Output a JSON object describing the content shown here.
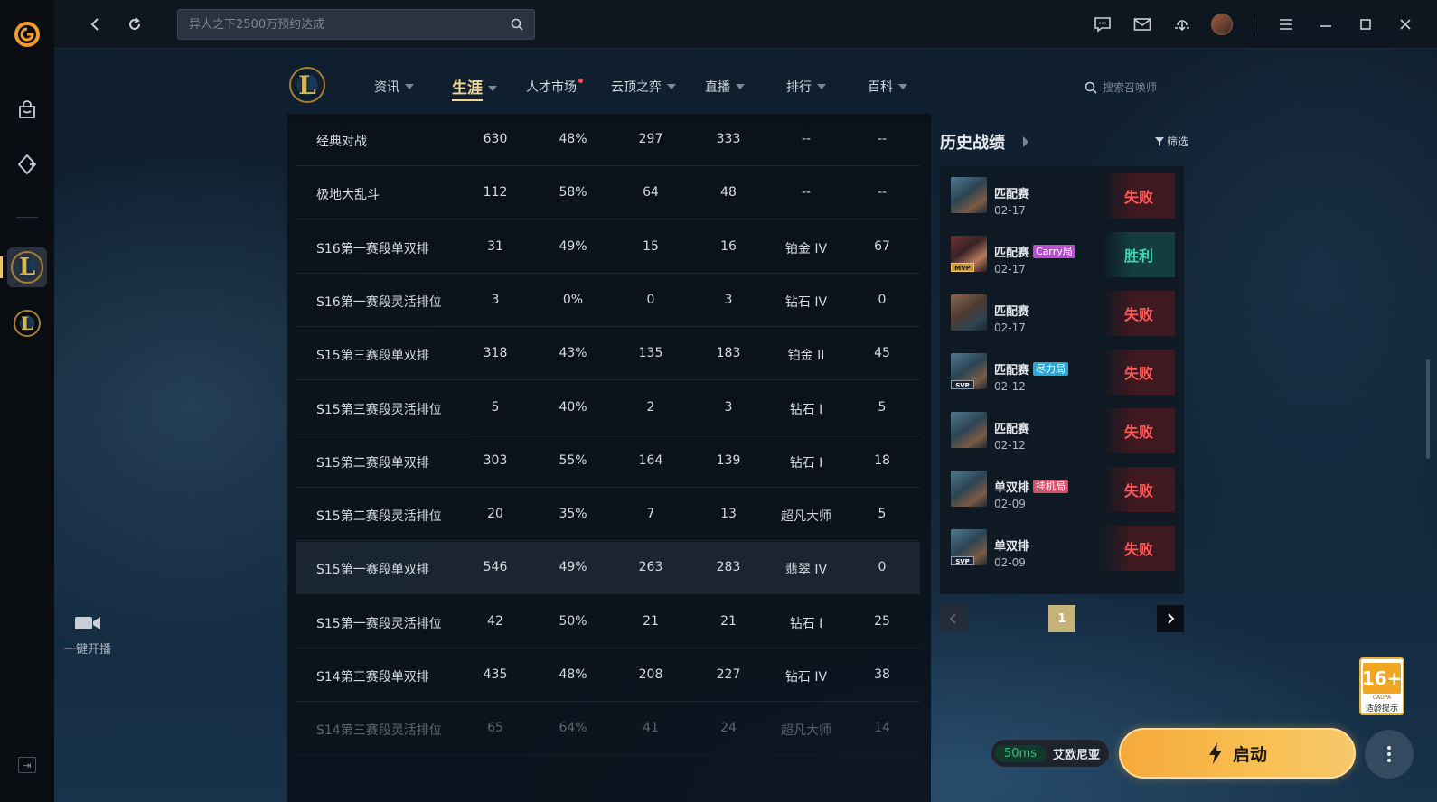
{
  "topbar": {
    "search_placeholder": "异人之下2500万预约达成",
    "icons": [
      "back-icon",
      "refresh-icon",
      "search-icon",
      "chat-icon",
      "mail-icon",
      "download-icon",
      "avatar",
      "menu-icon",
      "minimize-icon",
      "maximize-icon",
      "close-icon"
    ]
  },
  "rail": {
    "stream_label": "一键开播"
  },
  "game_nav": {
    "items": [
      {
        "label": "资讯"
      },
      {
        "label": "生涯"
      },
      {
        "label": "人才市场"
      },
      {
        "label": "云顶之弈"
      },
      {
        "label": "直播"
      },
      {
        "label": "排行"
      },
      {
        "label": "百科"
      }
    ],
    "active": "生涯",
    "summoner_search_placeholder": "搜索召唤师"
  },
  "stats": {
    "rows": [
      {
        "mode": "经典对战",
        "games": "630",
        "winrate": "48%",
        "wins": "297",
        "losses": "333",
        "rank": "--",
        "points": "--"
      },
      {
        "mode": "极地大乱斗",
        "games": "112",
        "winrate": "58%",
        "wins": "64",
        "losses": "48",
        "rank": "--",
        "points": "--"
      },
      {
        "mode": "S16第一赛段单双排",
        "games": "31",
        "winrate": "49%",
        "wins": "15",
        "losses": "16",
        "rank": "铂金 IV",
        "points": "67"
      },
      {
        "mode": "S16第一赛段灵活排位",
        "games": "3",
        "winrate": "0%",
        "wins": "0",
        "losses": "3",
        "rank": "钻石 IV",
        "points": "0"
      },
      {
        "mode": "S15第三赛段单双排",
        "games": "318",
        "winrate": "43%",
        "wins": "135",
        "losses": "183",
        "rank": "铂金 II",
        "points": "45"
      },
      {
        "mode": "S15第三赛段灵活排位",
        "games": "5",
        "winrate": "40%",
        "wins": "2",
        "losses": "3",
        "rank": "钻石 I",
        "points": "5"
      },
      {
        "mode": "S15第二赛段单双排",
        "games": "303",
        "winrate": "55%",
        "wins": "164",
        "losses": "139",
        "rank": "钻石 I",
        "points": "18"
      },
      {
        "mode": "S15第二赛段灵活排位",
        "games": "20",
        "winrate": "35%",
        "wins": "7",
        "losses": "13",
        "rank": "超凡大师",
        "points": "5"
      },
      {
        "mode": "S15第一赛段单双排",
        "games": "546",
        "winrate": "49%",
        "wins": "263",
        "losses": "283",
        "rank": "翡翠 IV",
        "points": "0"
      },
      {
        "mode": "S15第一赛段灵活排位",
        "games": "42",
        "winrate": "50%",
        "wins": "21",
        "losses": "21",
        "rank": "钻石 I",
        "points": "25"
      },
      {
        "mode": "S14第三赛段单双排",
        "games": "435",
        "winrate": "48%",
        "wins": "208",
        "losses": "227",
        "rank": "钻石 IV",
        "points": "38"
      },
      {
        "mode": "S14第三赛段灵活排位",
        "games": "65",
        "winrate": "64%",
        "wins": "41",
        "losses": "24",
        "rank": "超凡大师",
        "points": "14"
      }
    ]
  },
  "history": {
    "title": "历史战绩",
    "filter_label": "筛选",
    "matches": [
      {
        "mode": "匹配赛",
        "tag": "",
        "date": "02-17",
        "result": "失败",
        "badge": ""
      },
      {
        "mode": "匹配赛",
        "tag": "Carry局",
        "date": "02-17",
        "result": "胜利",
        "badge": "MVP"
      },
      {
        "mode": "匹配赛",
        "tag": "",
        "date": "02-17",
        "result": "失败",
        "badge": ""
      },
      {
        "mode": "匹配赛",
        "tag": "尽力局",
        "date": "02-12",
        "result": "失败",
        "badge": "SVP"
      },
      {
        "mode": "匹配赛",
        "tag": "",
        "date": "02-12",
        "result": "失败",
        "badge": ""
      },
      {
        "mode": "单双排",
        "tag": "挂机局",
        "date": "02-09",
        "result": "失败",
        "badge": ""
      },
      {
        "mode": "单双排",
        "tag": "",
        "date": "02-09",
        "result": "失败",
        "badge": "SVP"
      }
    ],
    "page": "1"
  },
  "bottom": {
    "age_rating": "16+",
    "age_sub": "CADPA",
    "age_note": "适龄提示",
    "ping": "50ms",
    "server": "艾欧尼亚",
    "launch_label": "启动"
  },
  "colors": {
    "accent_gold": "#f0d899",
    "lose": "#ff5a5a",
    "win": "#3fd6b0",
    "launch": "#f6a93b",
    "tag_carry": "#b84fd0",
    "tag_effort": "#2aa8d8",
    "tag_afk": "#d9506a"
  }
}
